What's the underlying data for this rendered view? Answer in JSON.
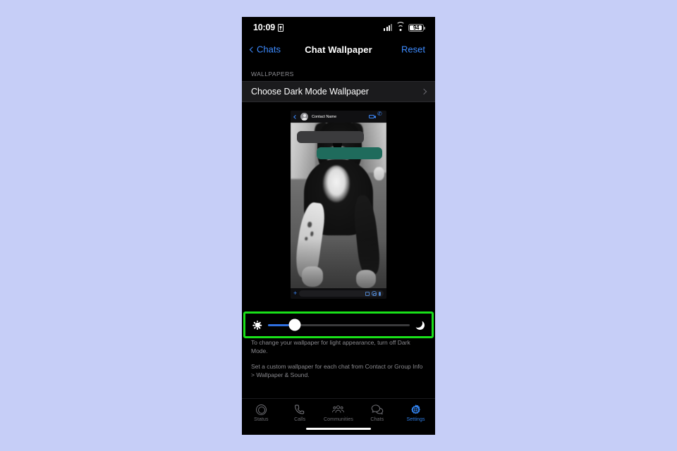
{
  "theme": {
    "page_background": "#c6cef7",
    "phone_background": "#000000",
    "accent_blue": "#3d8bff",
    "highlight_green": "#19e019",
    "outgoing_bubble": "#1f6b5c",
    "incoming_bubble": "#3b3b3d",
    "secondary_text": "#8a8a8f"
  },
  "status_bar": {
    "time": "10:09",
    "lock_icon": "lock-icon",
    "cellular_icon": "cellular-signal-icon",
    "wifi_icon": "wifi-icon",
    "battery_percent": "94",
    "battery_icon": "battery-icon"
  },
  "nav_bar": {
    "back_label": "Chats",
    "back_icon": "chevron-left-icon",
    "title": "Chat Wallpaper",
    "action_label": "Reset"
  },
  "wallpapers_section": {
    "header": "WALLPAPERS",
    "row_label": "Choose Dark Mode Wallpaper",
    "row_chevron_icon": "chevron-right-icon"
  },
  "preview": {
    "back_icon": "chevron-left-icon",
    "avatar_icon": "contact-avatar-icon",
    "contact_name": "Contact Name",
    "video_call_icon": "video-camera-icon",
    "voice_call_icon": "phone-handset-icon",
    "wallpaper_description": "Black and white photograph of a dog lying down with front paws stretched forward",
    "bubbles": [
      {
        "side": "incoming",
        "text": ""
      },
      {
        "side": "outgoing",
        "text": ""
      }
    ],
    "input_plus_icon": "plus-icon",
    "input_placeholder": "",
    "sticker_icon": "sticker-icon",
    "camera_icon": "camera-icon",
    "mic_icon": "microphone-icon"
  },
  "brightness_slider": {
    "light_icon": "sun-icon",
    "dark_icon": "moon-icon",
    "value_percent": 19,
    "highlighted": true
  },
  "footer": {
    "paragraph_1": "To change your wallpaper for light appearance, turn off Dark Mode.",
    "paragraph_2": "Set a custom wallpaper for each chat from Contact or Group Info > Wallpaper & Sound."
  },
  "tab_bar": {
    "items": [
      {
        "label": "Status",
        "icon": "status-rings-icon",
        "active": false
      },
      {
        "label": "Calls",
        "icon": "phone-handset-icon",
        "active": false
      },
      {
        "label": "Communities",
        "icon": "communities-people-icon",
        "active": false
      },
      {
        "label": "Chats",
        "icon": "chat-bubbles-icon",
        "active": false
      },
      {
        "label": "Settings",
        "icon": "gear-icon",
        "active": true
      }
    ]
  },
  "home_indicator": "home-indicator"
}
